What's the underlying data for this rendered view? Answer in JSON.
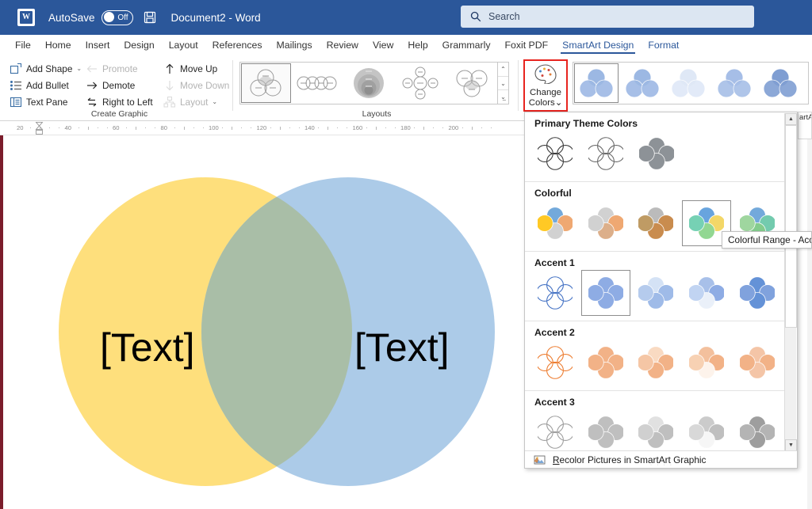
{
  "titlebar": {
    "autosave_label": "AutoSave",
    "autosave_state": "Off",
    "document_title": "Document2",
    "title_separator": "-",
    "app_name": "Word",
    "word_logo_glyph": "W",
    "save_icon": "save-icon"
  },
  "search": {
    "placeholder": "Search",
    "icon": "search-icon"
  },
  "tabs": [
    {
      "label": "File",
      "state": "normal"
    },
    {
      "label": "Home",
      "state": "normal"
    },
    {
      "label": "Insert",
      "state": "normal"
    },
    {
      "label": "Design",
      "state": "normal"
    },
    {
      "label": "Layout",
      "state": "normal"
    },
    {
      "label": "References",
      "state": "normal"
    },
    {
      "label": "Mailings",
      "state": "normal"
    },
    {
      "label": "Review",
      "state": "normal"
    },
    {
      "label": "View",
      "state": "normal"
    },
    {
      "label": "Help",
      "state": "normal"
    },
    {
      "label": "Grammarly",
      "state": "normal"
    },
    {
      "label": "Foxit PDF",
      "state": "normal"
    },
    {
      "label": "SmartArt Design",
      "state": "active"
    },
    {
      "label": "Format",
      "state": "contextual"
    }
  ],
  "ribbon": {
    "create_graphic": {
      "group_label": "Create Graphic",
      "col1": [
        {
          "label": "Add Shape",
          "icon": "add-shape-icon",
          "disabled": false,
          "caret": "⌄"
        },
        {
          "label": "Add Bullet",
          "icon": "add-bullet-icon",
          "disabled": false,
          "caret": ""
        },
        {
          "label": "Text Pane",
          "icon": "text-pane-icon",
          "disabled": false,
          "caret": ""
        }
      ],
      "col2": [
        {
          "label": "Promote",
          "icon": "arrow-left-icon",
          "disabled": true,
          "caret": ""
        },
        {
          "label": "Demote",
          "icon": "arrow-right-icon",
          "disabled": false,
          "caret": ""
        },
        {
          "label": "Right to Left",
          "icon": "swap-icon",
          "disabled": false,
          "caret": ""
        }
      ],
      "col3": [
        {
          "label": "Move Up",
          "icon": "arrow-up-icon",
          "disabled": false,
          "caret": ""
        },
        {
          "label": "Move Down",
          "icon": "arrow-down-icon",
          "disabled": true,
          "caret": ""
        },
        {
          "label": "Layout",
          "icon": "layout-icon",
          "disabled": true,
          "caret": "⌄"
        }
      ]
    },
    "layouts": {
      "group_label": "Layouts",
      "items": [
        {
          "name": "basic-venn-layout",
          "selected": true
        },
        {
          "name": "linear-venn-layout",
          "selected": false
        },
        {
          "name": "stacked-venn-layout",
          "selected": false
        },
        {
          "name": "radial-venn-layout",
          "selected": false
        },
        {
          "name": "basic-venn-alt-layout",
          "selected": false
        }
      ],
      "scroll_up": "⌃",
      "scroll_down": "⌄",
      "scroll_more": "⌄̲"
    },
    "change_colors": {
      "label_line1": "Change",
      "label_line2": "Colors",
      "caret": "⌄",
      "icon": "palette-icon",
      "highlight_color": "#e8241f"
    },
    "smartart_styles": {
      "group_label_partial": "artArt",
      "items": [
        {
          "name": "style-simple-fill",
          "selected": true
        },
        {
          "name": "style-white-outline",
          "selected": false
        },
        {
          "name": "style-subtle-effect",
          "selected": false
        },
        {
          "name": "style-moderate",
          "selected": false
        },
        {
          "name": "style-intense",
          "selected": false
        }
      ]
    }
  },
  "ruler": {
    "ticks": [
      20,
      40,
      60,
      80,
      100,
      120,
      140,
      160,
      180,
      200
    ],
    "indent_marker": "indent-marker"
  },
  "document": {
    "venn": {
      "left_label": "[Text]",
      "right_label": "[Text]",
      "left_color": "#FEDF7C",
      "right_color": "#ACCBE8",
      "overlap_color": "#A9BEA7",
      "text_color": "#000000"
    }
  },
  "dropdown": {
    "sections": [
      {
        "title": "Primary Theme Colors",
        "items": [
          {
            "name": "dark-outline",
            "selected": false,
            "colors": [
              "#3a3a3a",
              "#3a3a3a",
              "#3a3a3a",
              "#3a3a3a"
            ],
            "style": "outline"
          },
          {
            "name": "dark-outline-2",
            "selected": false,
            "colors": [
              "#6a6a6a",
              "#6a6a6a",
              "#6a6a6a",
              "#6a6a6a"
            ],
            "style": "outline"
          },
          {
            "name": "dark-fill",
            "selected": false,
            "colors": [
              "#7a7f85",
              "#7a7f85",
              "#7a7f85",
              "#7a7f85"
            ],
            "style": "fill"
          }
        ]
      },
      {
        "title": "Colorful",
        "items": [
          {
            "name": "colorful-accent-colors",
            "selected": false,
            "colors": [
              "#5b9bd5",
              "#ed9a5a",
              "#c9c9c9",
              "#ffc000"
            ],
            "style": "fill"
          },
          {
            "name": "colorful-range-accent-2-3",
            "selected": false,
            "colors": [
              "#c9c9c9",
              "#ed9a5a",
              "#d7a276",
              "#c9c9c9"
            ],
            "style": "fill"
          },
          {
            "name": "colorful-range-accent-3-4",
            "selected": false,
            "colors": [
              "#b0b0b0",
              "#c07830",
              "#c07830",
              "#b58a4a"
            ],
            "style": "fill"
          },
          {
            "name": "colorful-range-accent-4-5",
            "selected": true,
            "colors": [
              "#4e95d9",
              "#f2d14e",
              "#7fd17f",
              "#5fc9a8"
            ],
            "style": "fill"
          },
          {
            "name": "colorful-range-accent-5-6",
            "selected": false,
            "colors": [
              "#5b9bd5",
              "#5bc2a0",
              "#6fc47a",
              "#8fd08f"
            ],
            "style": "fill"
          }
        ]
      },
      {
        "title": "Accent 1",
        "items": [
          {
            "name": "accent1-outline",
            "selected": false,
            "colors": [
              "#4472c4",
              "#4472c4",
              "#4472c4",
              "#4472c4"
            ],
            "style": "outline"
          },
          {
            "name": "accent1-colored-fill",
            "selected": true,
            "colors": [
              "#7b9ee0",
              "#7b9ee0",
              "#7b9ee0",
              "#7b9ee0"
            ],
            "style": "fill"
          },
          {
            "name": "accent1-gradient-range",
            "selected": false,
            "colors": [
              "#cdddf4",
              "#8fb0e4",
              "#8fb0e4",
              "#a9c2ea"
            ],
            "style": "fill"
          },
          {
            "name": "accent1-gradient-loop",
            "selected": false,
            "colors": [
              "#9ab6e6",
              "#7b9ee0",
              "#e7eef9",
              "#b7cdf0"
            ],
            "style": "fill"
          },
          {
            "name": "accent1-transparent",
            "selected": false,
            "colors": [
              "#4a7fd1",
              "#6b92d8",
              "#4a7fd1",
              "#6b92d8"
            ],
            "style": "fill"
          }
        ]
      },
      {
        "title": "Accent 2",
        "items": [
          {
            "name": "accent2-outline",
            "selected": false,
            "colors": [
              "#ed7d31",
              "#ed7d31",
              "#ed7d31",
              "#ed7d31"
            ],
            "style": "outline"
          },
          {
            "name": "accent2-colored-fill",
            "selected": false,
            "colors": [
              "#f0a573",
              "#f0a573",
              "#f0a573",
              "#f0a573"
            ],
            "style": "fill"
          },
          {
            "name": "accent2-gradient-range",
            "selected": false,
            "colors": [
              "#f8d4b8",
              "#f0a573",
              "#f0a573",
              "#f4bd96"
            ],
            "style": "fill"
          },
          {
            "name": "accent2-gradient-loop",
            "selected": false,
            "colors": [
              "#f2b68d",
              "#f0a573",
              "#fdf1e8",
              "#f6c9a6"
            ],
            "style": "fill"
          },
          {
            "name": "accent2-transparent",
            "selected": false,
            "colors": [
              "#f3bc98",
              "#f0a573",
              "#f3bc98",
              "#f0a573"
            ],
            "style": "fill"
          }
        ]
      },
      {
        "title": "Accent 3",
        "items": [
          {
            "name": "accent3-outline",
            "selected": false,
            "colors": [
              "#9e9e9e",
              "#9e9e9e",
              "#9e9e9e",
              "#9e9e9e"
            ],
            "style": "outline"
          },
          {
            "name": "accent3-colored-fill",
            "selected": false,
            "colors": [
              "#b5b5b5",
              "#b5b5b5",
              "#b5b5b5",
              "#b5b5b5"
            ],
            "style": "fill"
          },
          {
            "name": "accent3-gradient-range",
            "selected": false,
            "colors": [
              "#dcdcdc",
              "#b5b5b5",
              "#b5b5b5",
              "#c8c8c8"
            ],
            "style": "fill"
          },
          {
            "name": "accent3-gradient-loop",
            "selected": false,
            "colors": [
              "#c2c2c2",
              "#b5b5b5",
              "#f5f5f5",
              "#d2d2d2"
            ],
            "style": "fill"
          },
          {
            "name": "accent3-transparent",
            "selected": false,
            "colors": [
              "#8e8e8e",
              "#a8a8a8",
              "#8e8e8e",
              "#a8a8a8"
            ],
            "style": "fill"
          }
        ]
      }
    ],
    "footer": {
      "label_underlined": "R",
      "label_rest": "ecolor Pictures in SmartArt Graphic",
      "icon": "recolor-pictures-icon"
    },
    "scrollbar": {
      "up_arrow": "▲",
      "down_arrow": "▼"
    },
    "grip": "· · · ·"
  },
  "tooltip": {
    "text": "Colorful Range - Accen"
  },
  "pane_remnant": {
    "text": "artAr"
  }
}
